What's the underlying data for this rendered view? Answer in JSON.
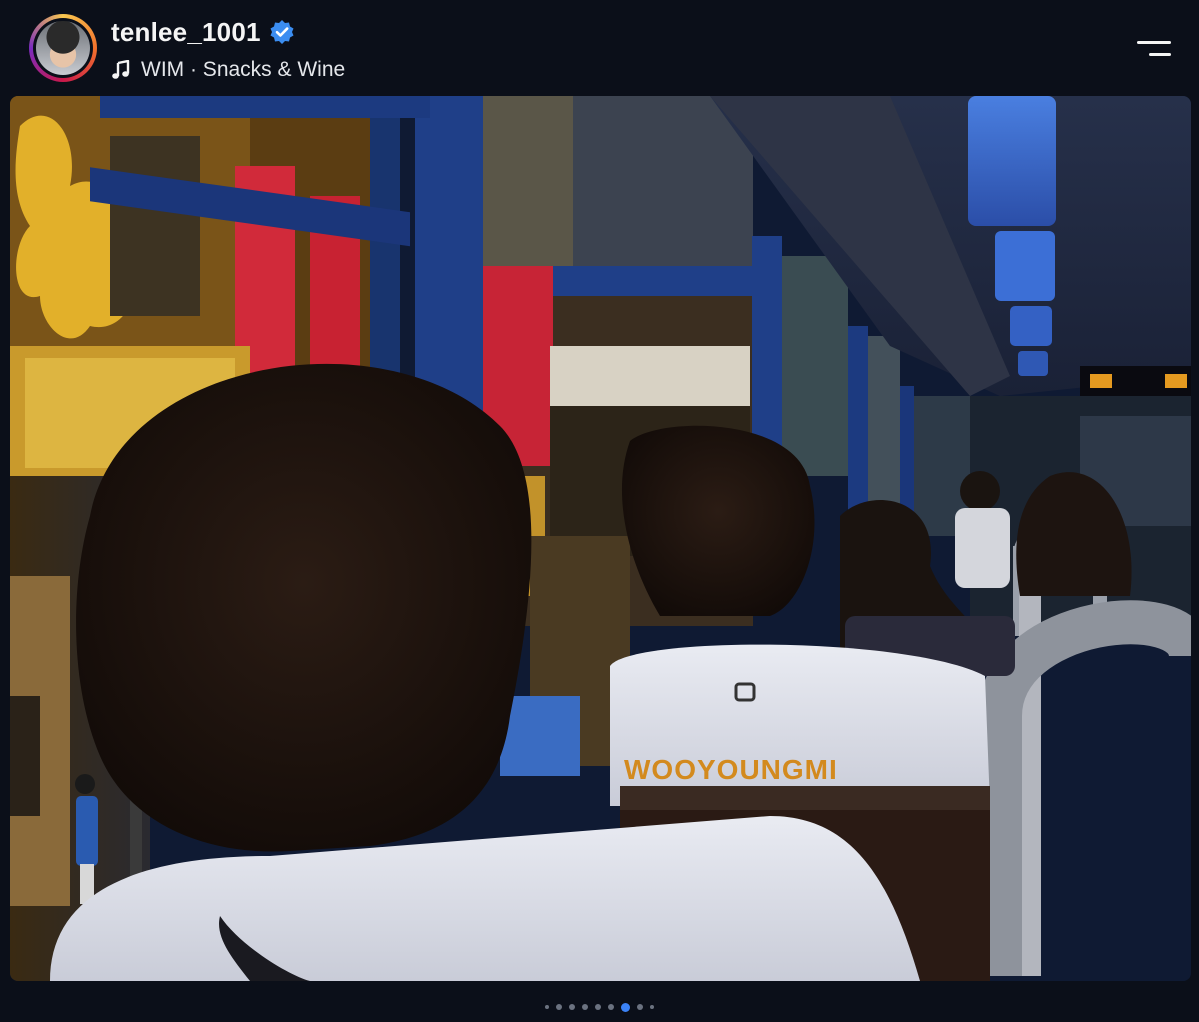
{
  "post": {
    "username": "tenlee_1001",
    "verified": true,
    "music": "WIM · Snacks & Wine",
    "photo_alt_text_visible_on_shirt": "WOOYOUNGMI"
  },
  "carousel": {
    "total_dots": 9,
    "active_index": 6
  },
  "colors": {
    "background": "#0b0f19",
    "verified_badge": "#3b8df1",
    "active_dot": "#3b82f6",
    "inactive_dot": "#6b7280"
  },
  "icons": {
    "music": "music-note-icon",
    "verified": "verified-badge-icon",
    "menu": "menu-icon"
  }
}
